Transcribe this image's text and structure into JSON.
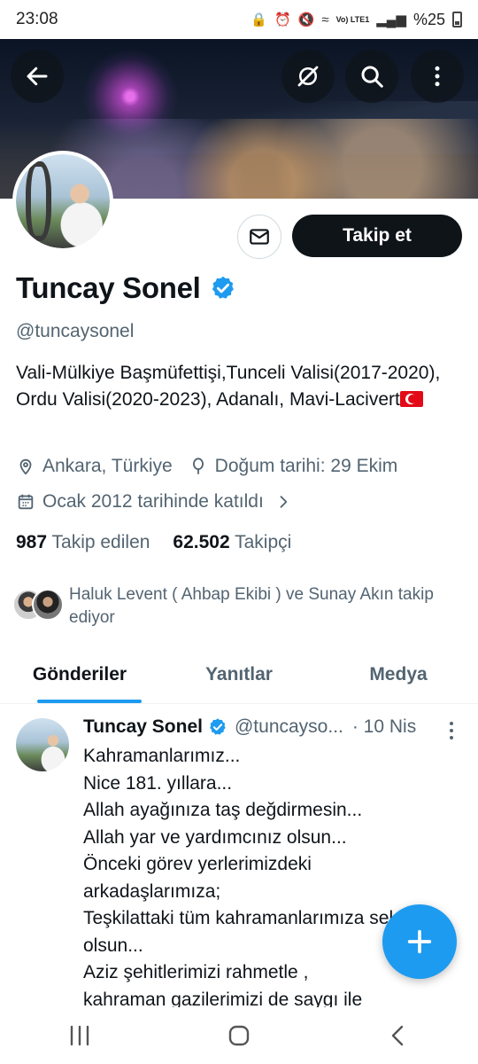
{
  "status_bar": {
    "time": "23:08",
    "network": "Vo) LTE1",
    "battery": "%25"
  },
  "profile": {
    "display_name": "Tuncay Sonel",
    "handle": "@tuncaysonel",
    "bio": "Vali-Mülkiye Başmüfettişi,Tunceli Valisi(2017-2020), Ordu Valisi(2020-2023), Adanalı, Mavi-Lacivert",
    "location": "Ankara, Türkiye",
    "birthday": "Doğum tarihi: 29 Ekim",
    "joined": "Ocak 2012 tarihinde katıldı",
    "following_count": "987",
    "following_label": "Takip edilen",
    "followers_count": "62.502",
    "followers_label": "Takipçi",
    "followed_by": "Haluk Levent ( Ahbap Ekibi ) ve Sunay Akın takip ediyor",
    "follow_button": "Takip et"
  },
  "tabs": [
    {
      "label": "Gönderiler",
      "active": true
    },
    {
      "label": "Yanıtlar",
      "active": false
    },
    {
      "label": "Medya",
      "active": false
    }
  ],
  "tweet": {
    "name": "Tuncay Sonel",
    "handle": "@tuncayso...",
    "time": "· 10 Nis",
    "text": "Kahramanlarımız...\nNice 181. yıllara...\nAllah ayağınıza taş değdirmesin...\nAllah yar ve yardımcınız olsun...\nÖnceki görev yerlerimizdeki\narkadaşlarımıza;\nTeşkilattaki tüm kahramanlarımıza selam\nolsun...\nAziz şehitlerimizi rahmetle ,\nkahraman gazilerimizi de saygı ile"
  },
  "icons": {
    "back": "arrow-left-icon",
    "grok": "grok-icon",
    "search": "search-icon",
    "more": "more-vertical-icon",
    "message": "mail-icon",
    "verified": "verified-badge-icon",
    "location": "location-pin-icon",
    "birthday": "balloon-icon",
    "calendar": "calendar-icon",
    "compose": "plus-icon"
  },
  "colors": {
    "accent": "#1d9bf0",
    "text_primary": "#0f1419",
    "text_secondary": "#536471",
    "button_dark": "#0f1419"
  }
}
